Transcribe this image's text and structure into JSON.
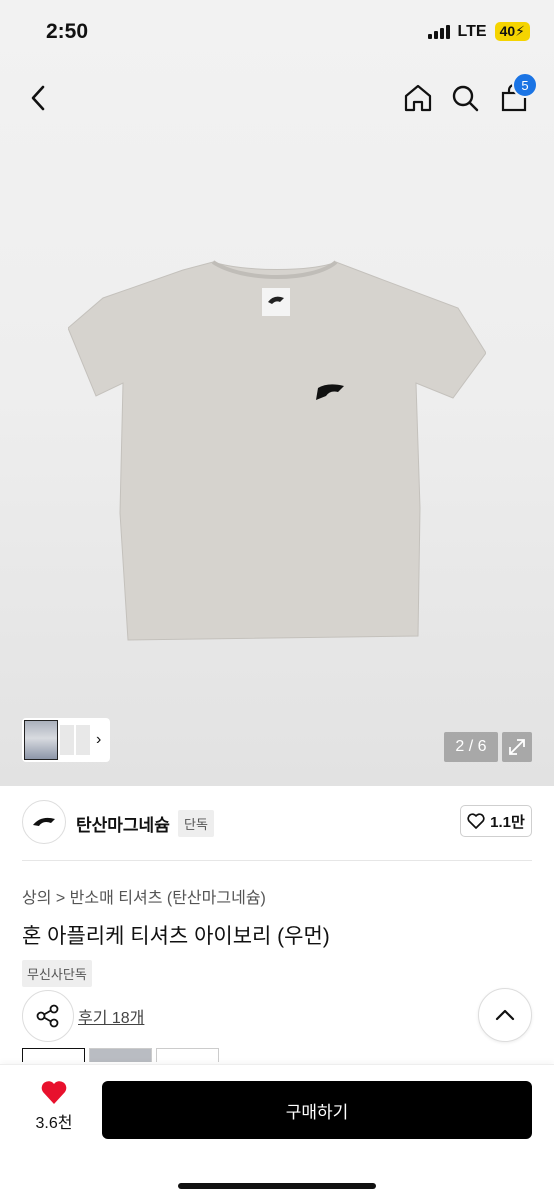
{
  "status": {
    "time": "2:50",
    "network": "LTE",
    "battery": "40"
  },
  "nav": {
    "cart_count": "5"
  },
  "gallery": {
    "counter": "2 / 6"
  },
  "brand": {
    "name": "탄산마그네슘",
    "tag": "단독",
    "likes": "1.1만"
  },
  "product": {
    "breadcrumb": "상의 > 반소매 티셔츠 (탄산마그네슘)",
    "title": "혼 아플리케 티셔츠 아이보리 (우먼)",
    "badge": "무신사단독",
    "reviews": "후기 18개"
  },
  "bottom": {
    "like_count": "3.6천",
    "buy_label": "구매하기"
  },
  "colors": {
    "accent_blue": "#1b74e4",
    "heart_red": "#e8112d",
    "buy_bg": "#000000"
  }
}
